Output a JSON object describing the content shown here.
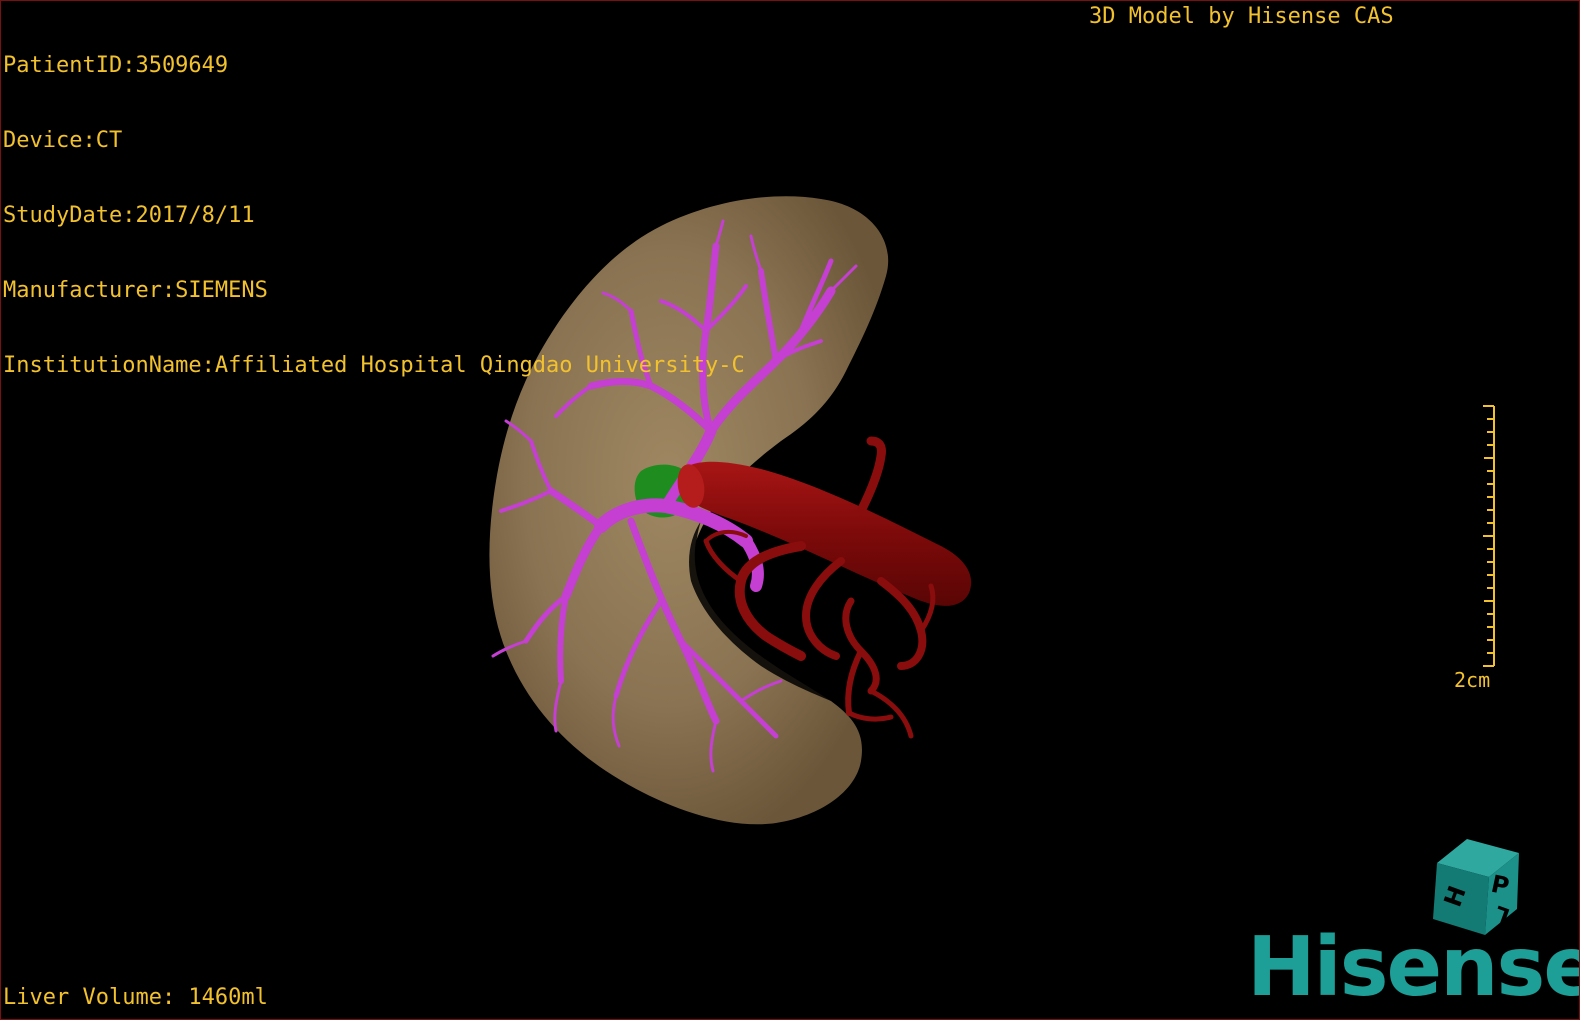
{
  "header": {
    "patient_id": "PatientID:3509649",
    "device": "Device:CT",
    "study_date": "StudyDate:2017/8/11",
    "manufacturer": "Manufacturer:SIEMENS",
    "institution": "InstitutionName:Affiliated Hospital Qingdao University-C",
    "brand_caption": "3D Model by Hisense CAS"
  },
  "footer": {
    "liver_volume": "Liver Volume: 1460ml"
  },
  "scale_bar": {
    "label": "2cm"
  },
  "orientation_cube": {
    "faces": [
      "P",
      "H",
      "L"
    ]
  },
  "logo": {
    "text": "Hisense"
  },
  "colors": {
    "overlay_text": "#f2c12e",
    "liver": "#8c7656",
    "portal_vein": "#c43fd2",
    "artery": "#8a0d0d",
    "gallbladder": "#1e8c1e",
    "brand": "#1d9e96",
    "border": "#7a1010"
  }
}
